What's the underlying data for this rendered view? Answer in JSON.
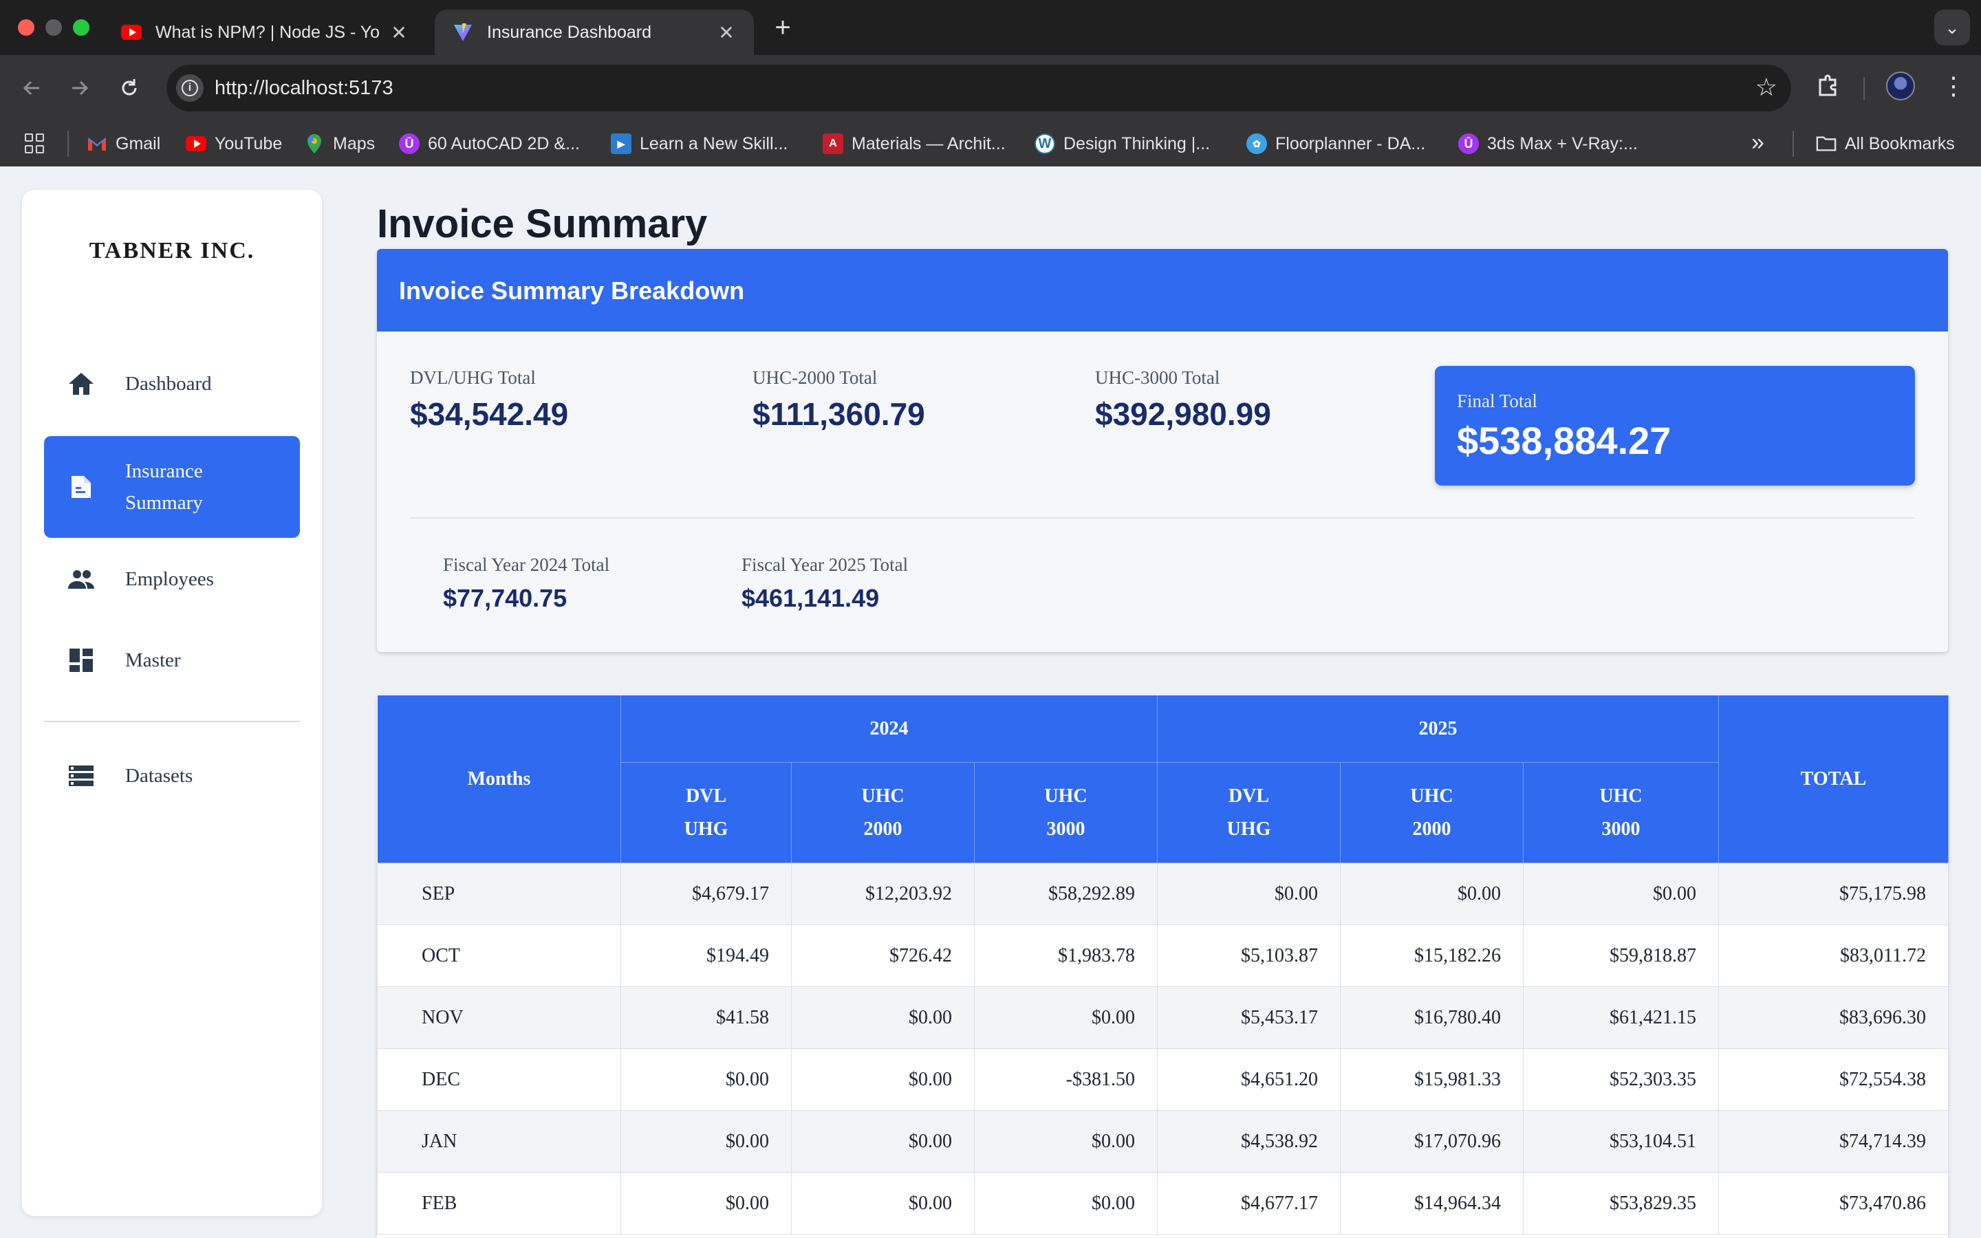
{
  "browser": {
    "tabs": [
      {
        "title": "What is NPM? | Node JS - Yo",
        "close": "✕",
        "icon": "youtube-icon"
      },
      {
        "title": "Insurance Dashboard",
        "close": "✕",
        "icon": "vite-icon"
      }
    ],
    "new_tab": "+",
    "tab_menu": "⌄",
    "url": "http://localhost:5173",
    "bookmarks": [
      {
        "label": "Gmail",
        "icon": "gmail-icon"
      },
      {
        "label": "YouTube",
        "icon": "youtube-icon"
      },
      {
        "label": "Maps",
        "icon": "maps-icon"
      },
      {
        "label": "60 AutoCAD 2D &...",
        "icon": "udemy-icon"
      },
      {
        "label": "Learn a New Skill...",
        "icon": "video-icon"
      },
      {
        "label": "Materials — Archit...",
        "icon": "archi-icon"
      },
      {
        "label": "Design Thinking |...",
        "icon": "wordpress-icon"
      },
      {
        "label": "Floorplanner - DA...",
        "icon": "floorplanner-icon"
      },
      {
        "label": "3ds Max + V-Ray:...",
        "icon": "udemy-icon"
      }
    ],
    "more_bookmarks": "»",
    "all_bookmarks": "All Bookmarks"
  },
  "sidebar": {
    "brand": "TABNER INC.",
    "items": [
      {
        "label": "Dashboard",
        "icon": "home-icon"
      },
      {
        "label": "Insurance Summary",
        "icon": "document-icon",
        "active": true
      },
      {
        "label": "Employees",
        "icon": "people-icon"
      },
      {
        "label": "Master",
        "icon": "dashboard-grid-icon"
      },
      {
        "label": "Datasets",
        "icon": "storage-list-icon"
      }
    ]
  },
  "page": {
    "title": "Invoice Summary",
    "summary": {
      "header": "Invoice Summary Breakdown",
      "dvl_uhg_label": "DVL/UHG Total",
      "dvl_uhg_value": "$34,542.49",
      "uhc2000_label": "UHC-2000 Total",
      "uhc2000_value": "$111,360.79",
      "uhc3000_label": "UHC-3000 Total",
      "uhc3000_value": "$392,980.99",
      "final_label": "Final Total",
      "final_value": "$538,884.27",
      "fy2024_label": "Fiscal Year 2024 Total",
      "fy2024_value": "$77,740.75",
      "fy2025_label": "Fiscal Year 2025 Total",
      "fy2025_value": "$461,141.49"
    },
    "table": {
      "months_header": "Months",
      "year1": "2024",
      "year2": "2025",
      "total_header": "TOTAL",
      "sub_headers": [
        [
          "DVL",
          "UHG"
        ],
        [
          "UHC",
          "2000"
        ],
        [
          "UHC",
          "3000"
        ],
        [
          "DVL",
          "UHG"
        ],
        [
          "UHC",
          "2000"
        ],
        [
          "UHC",
          "3000"
        ]
      ],
      "rows": [
        {
          "month": "SEP",
          "values": [
            "$4,679.17",
            "$12,203.92",
            "$58,292.89",
            "$0.00",
            "$0.00",
            "$0.00",
            "$75,175.98"
          ]
        },
        {
          "month": "OCT",
          "values": [
            "$194.49",
            "$726.42",
            "$1,983.78",
            "$5,103.87",
            "$15,182.26",
            "$59,818.87",
            "$83,011.72"
          ]
        },
        {
          "month": "NOV",
          "values": [
            "$41.58",
            "$0.00",
            "$0.00",
            "$5,453.17",
            "$16,780.40",
            "$61,421.15",
            "$83,696.30"
          ]
        },
        {
          "month": "DEC",
          "values": [
            "$0.00",
            "$0.00",
            "-$381.50",
            "$4,651.20",
            "$15,981.33",
            "$52,303.35",
            "$72,554.38"
          ]
        },
        {
          "month": "JAN",
          "values": [
            "$0.00",
            "$0.00",
            "$0.00",
            "$4,538.92",
            "$17,070.96",
            "$53,104.51",
            "$74,714.39"
          ]
        },
        {
          "month": "FEB",
          "values": [
            "$0.00",
            "$0.00",
            "$0.00",
            "$4,677.17",
            "$14,964.34",
            "$53,829.35",
            "$73,470.86"
          ]
        }
      ]
    }
  },
  "colors": {
    "accent": "#2f6af0",
    "value_text": "#1a2b6b",
    "page_bg": "#eef1f6"
  }
}
